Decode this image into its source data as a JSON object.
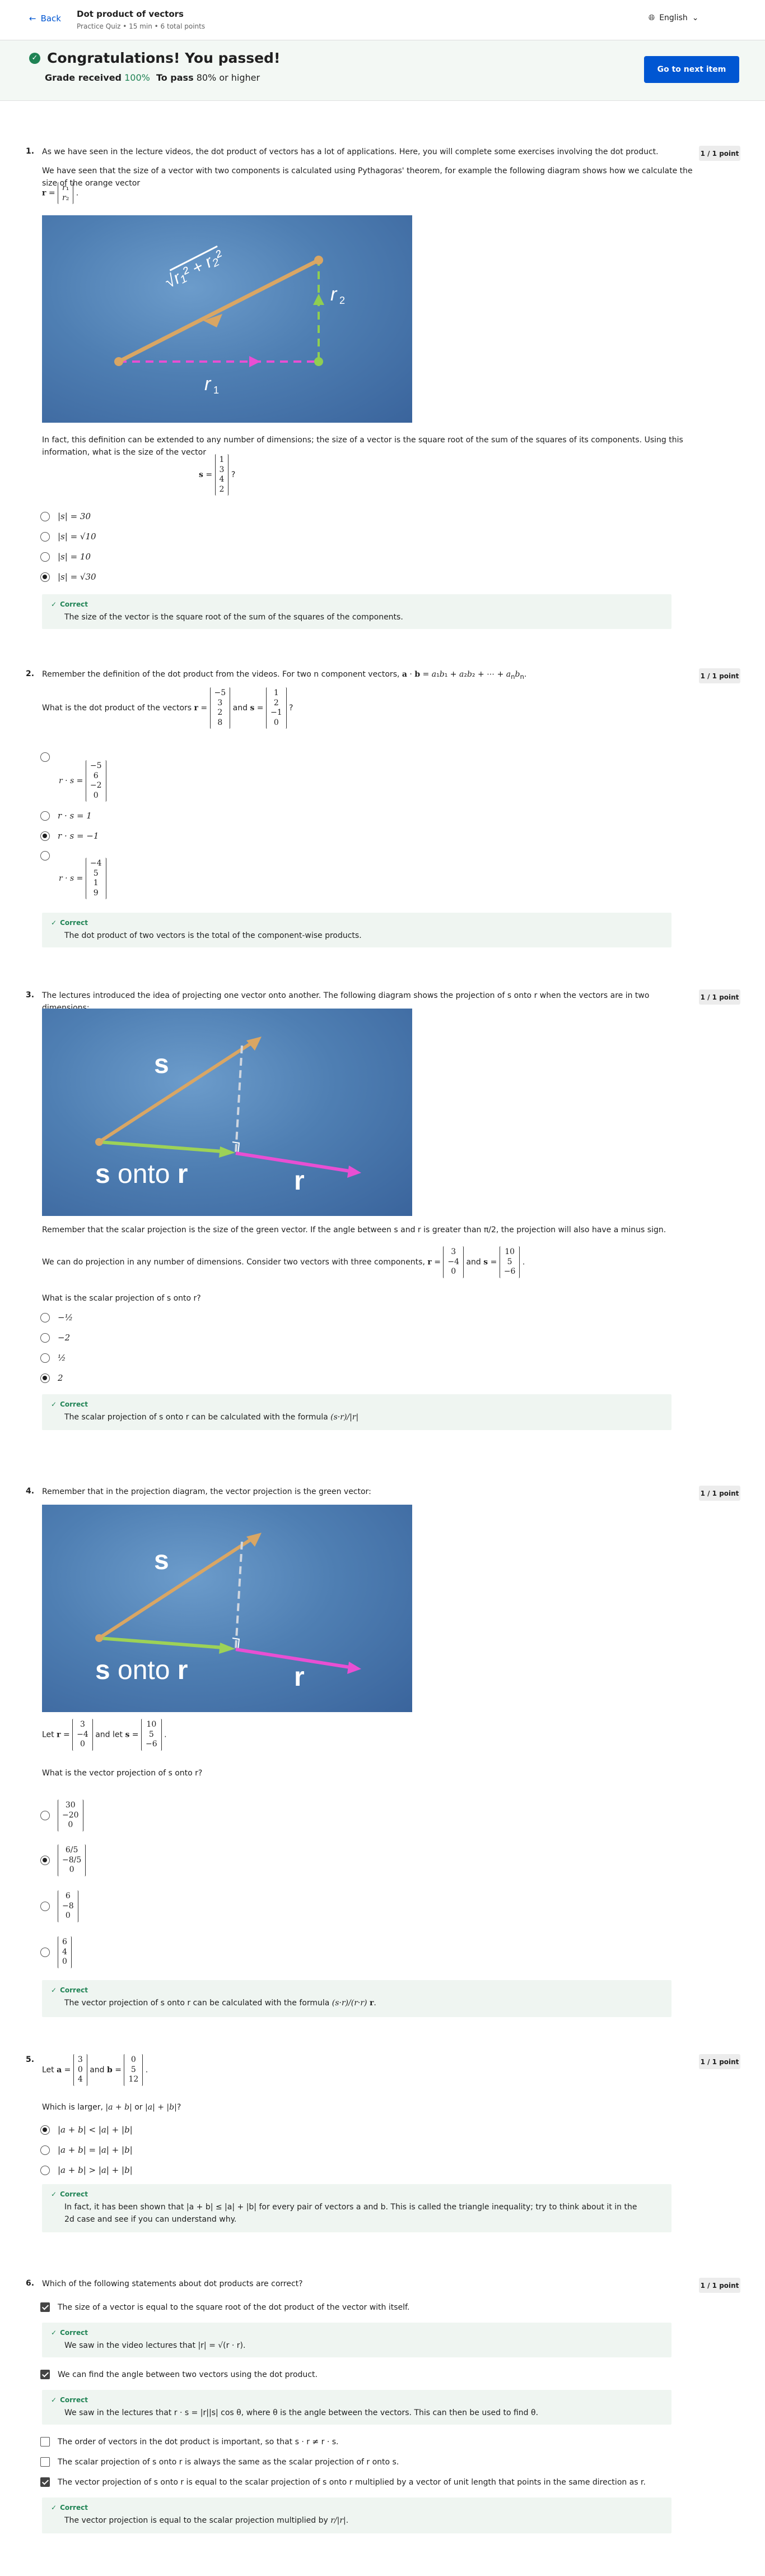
{
  "header": {
    "back": "Back",
    "title": "Dot product of vectors",
    "subtitle": "Practice Quiz • 15 min • 6 total points",
    "language": "English"
  },
  "banner": {
    "title": "Congratulations! You passed!",
    "grade_label": "Grade received",
    "grade_value": "100%",
    "pass_label": "To pass",
    "pass_value": "80% or higher",
    "button": "Go to next item"
  },
  "points": "1 / 1 point",
  "correct": "Correct",
  "q1": {
    "num": "1.",
    "p1": "As we have seen in the lecture videos, the dot product of vectors has a lot of applications. Here, you will complete some exercises involving the dot product.",
    "p2": "We have seen that the size of a vector with two components is calculated using Pythagoras' theorem, for example the following diagram shows how we calculate the size of the orange vector",
    "p3": "In fact, this definition can be extended to any number of dimensions; the size of a vector is the square root of the sum of the squares of its components. Using this information, what is the size of the vector",
    "opts": [
      "|s| = 30",
      "|s| = √10",
      "|s| = 10",
      "|s| = √30"
    ],
    "fb": "The size of the vector is the square root of the sum of the squares of the components."
  },
  "q2": {
    "num": "2.",
    "p1": "Remember the definition of the dot product from the videos. For two n component vectors,",
    "p2": "What is the dot product of the vectors",
    "opts": [
      "r · s =",
      "r · s = 1",
      "r · s = −1",
      "r · s ="
    ],
    "fb": "The dot product of two vectors is the total of the component-wise products."
  },
  "q3": {
    "num": "3.",
    "p1": "The lectures introduced the idea of projecting one vector onto another. The following diagram shows the projection of s onto r when the vectors are in two dimensions:",
    "p2": "Remember that the scalar projection is the size of the green vector. If the angle between s and r is greater than π/2, the projection will also have a minus sign.",
    "p3": "We can do projection in any number of dimensions. Consider two vectors with three components,",
    "p4": "What is the scalar projection of s onto r?",
    "opts": [
      "−½",
      "−2",
      "½",
      "2"
    ],
    "fb": "The scalar projection of s onto r can be calculated with the formula"
  },
  "q4": {
    "num": "4.",
    "p1": "Remember that in the projection diagram, the vector projection is the green vector:",
    "p2": "What is the vector projection of s onto r?",
    "fb": "The vector projection of s onto r can be calculated with the formula"
  },
  "q5": {
    "num": "5.",
    "p1": "Which is larger,",
    "opts": [
      "|a + b| < |a| + |b|",
      "|a + b| = |a| + |b|",
      "|a + b| > |a| + |b|"
    ],
    "fb": "In fact, it has been shown that |a + b| ≤ |a| + |b| for every pair of vectors a and b. This is called the triangle inequality; try to think about it in the 2d case and see if you can understand why."
  },
  "q6": {
    "num": "6.",
    "p1": "Which of the following statements about dot products are correct?",
    "opts": [
      "The size of a vector is equal to the square root of the dot product of the vector with itself.",
      "We can find the angle between two vectors using the dot product.",
      "The order of vectors in the dot product is important, so that s · r ≠ r · s.",
      "The scalar projection of s onto r is always the same as the scalar projection of r onto s.",
      "The vector projection of s onto r is equal to the scalar projection of s onto r multiplied by a vector of unit length that points in the same direction as r."
    ],
    "fb1": "We saw in the video lectures that |r| = √(r · r).",
    "fb2": "We saw in the lectures that r · s = |r||s| cos θ, where θ is the angle between the vectors. This can then be used to find θ.",
    "fb3": "The vector projection is equal to the scalar projection multiplied by"
  },
  "fig": {
    "s": "s",
    "r": "r",
    "onto": "s onto r"
  }
}
